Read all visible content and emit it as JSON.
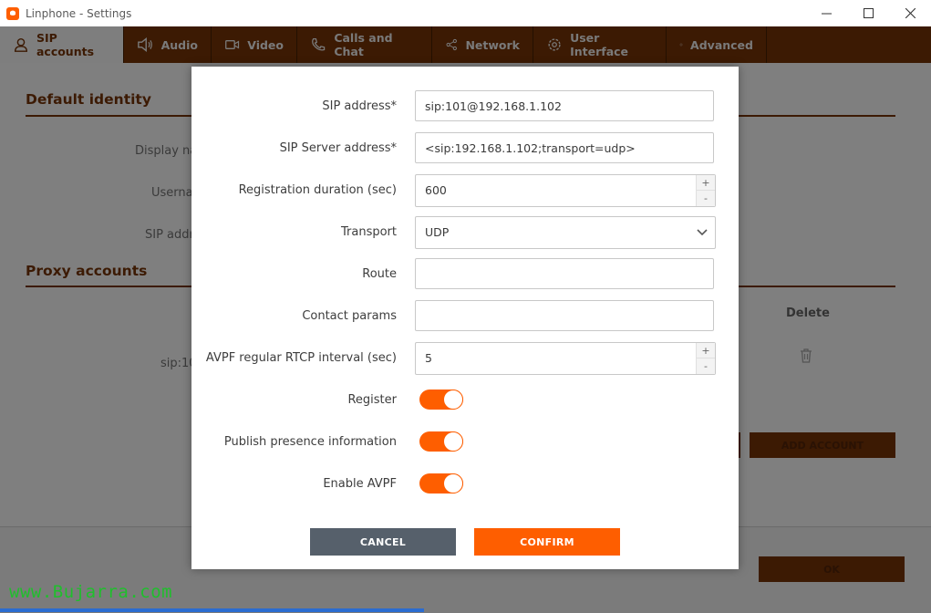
{
  "window": {
    "title": "Linphone - Settings"
  },
  "tabs": [
    {
      "label": "SIP accounts",
      "icon": "user-icon",
      "active": true
    },
    {
      "label": "Audio",
      "icon": "speaker-icon"
    },
    {
      "label": "Video",
      "icon": "camera-icon"
    },
    {
      "label": "Calls and Chat",
      "icon": "phone-icon"
    },
    {
      "label": "Network",
      "icon": "share-icon"
    },
    {
      "label": "User Interface",
      "icon": "gear-icon"
    },
    {
      "label": "Advanced",
      "icon": "gear-icon"
    }
  ],
  "background": {
    "default_identity_title": "Default identity",
    "display_name_label": "Display na",
    "username_label": "Userna",
    "sip_address_label": "SIP addr",
    "proxy_accounts_title": "Proxy accounts",
    "delete_header": "Delete",
    "proxy_row_sip": "sip:10",
    "add_account_label": "ADD ACCOUNT",
    "ok_label": "OK"
  },
  "modal": {
    "sip_address": {
      "label": "SIP address*",
      "value": "sip:101@192.168.1.102"
    },
    "sip_server_address": {
      "label": "SIP Server address*",
      "value": "<sip:192.168.1.102;transport=udp>"
    },
    "registration_duration": {
      "label": "Registration duration (sec)",
      "value": "600"
    },
    "transport": {
      "label": "Transport",
      "value": "UDP"
    },
    "route": {
      "label": "Route",
      "value": ""
    },
    "contact_params": {
      "label": "Contact params",
      "value": ""
    },
    "avpf_interval": {
      "label": "AVPF regular RTCP interval (sec)",
      "value": "5"
    },
    "register": {
      "label": "Register",
      "on": true
    },
    "publish_presence": {
      "label": "Publish presence information",
      "on": true
    },
    "enable_avpf": {
      "label": "Enable AVPF",
      "on": true
    },
    "cancel_label": "CANCEL",
    "confirm_label": "CONFIRM"
  },
  "watermark": "www.Bujarra.com",
  "colors": {
    "accent": "#fe5e00",
    "dark_brown": "#3c1a03",
    "cancel": "#56606b"
  }
}
